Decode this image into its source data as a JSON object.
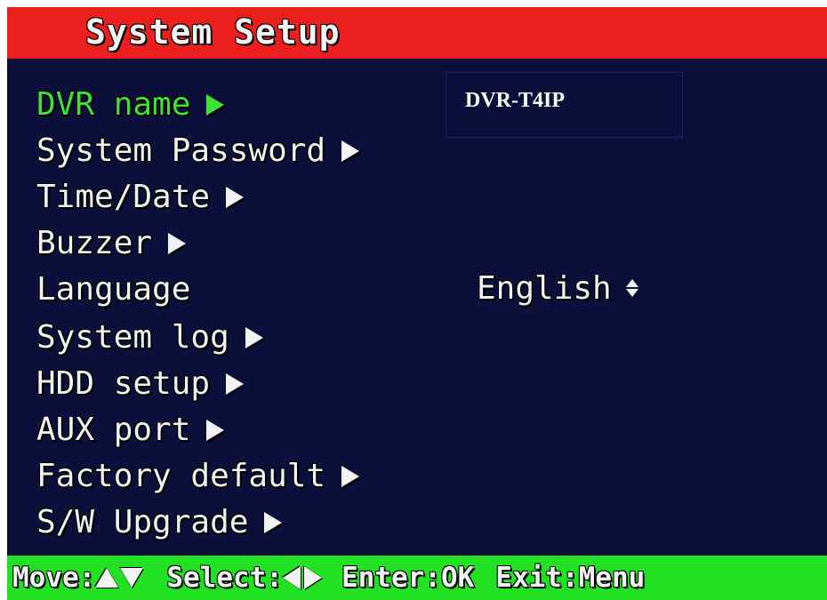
{
  "window": {
    "title": "System Setup"
  },
  "colors": {
    "title_bar": "#ec1f1f",
    "background": "#0b0f3a",
    "selected_item": "#3fe03a",
    "footer_bar": "#22e022",
    "text": "#f2f2f2"
  },
  "menu": {
    "items": [
      {
        "label": "DVR name",
        "has_arrow": true,
        "selected": true
      },
      {
        "label": "System Password",
        "has_arrow": true,
        "selected": false
      },
      {
        "label": "Time/Date",
        "has_arrow": true,
        "selected": false
      },
      {
        "label": "Buzzer",
        "has_arrow": true,
        "selected": false
      },
      {
        "label": "Language",
        "has_arrow": false,
        "selected": false
      },
      {
        "label": "System log",
        "has_arrow": true,
        "selected": false
      },
      {
        "label": "HDD setup",
        "has_arrow": true,
        "selected": false
      },
      {
        "label": "AUX port",
        "has_arrow": true,
        "selected": false
      },
      {
        "label": "Factory default",
        "has_arrow": true,
        "selected": false
      },
      {
        "label": "S/W Upgrade",
        "has_arrow": true,
        "selected": false
      }
    ]
  },
  "dvr_name": {
    "value": "DVR-T4IP"
  },
  "language": {
    "value": "English",
    "icon": "up-down-arrows-icon"
  },
  "footer": {
    "move_label": "Move:",
    "select_label": "Select:",
    "enter_label": "Enter:OK",
    "exit_label": "Exit:Menu"
  }
}
